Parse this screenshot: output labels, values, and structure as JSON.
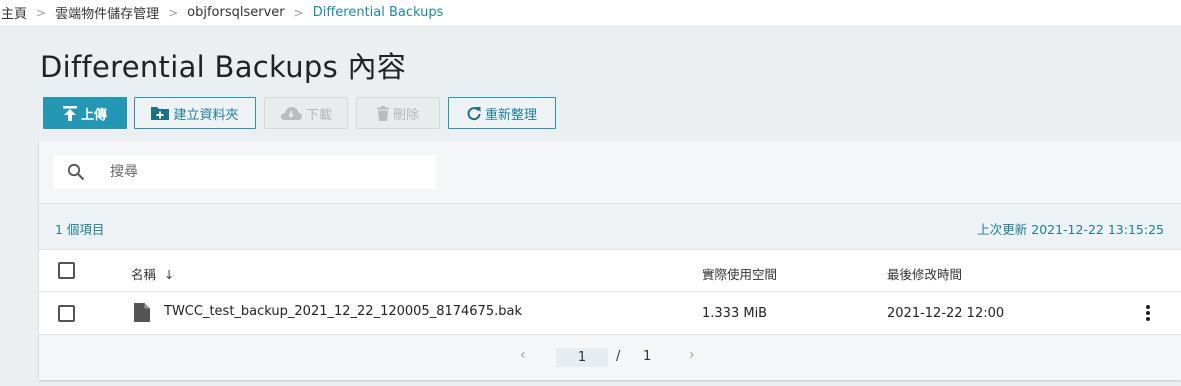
{
  "breadcrumb": {
    "items": [
      "主頁",
      "雲端物件儲存管理",
      "objforsqlserver",
      "Differential Backups"
    ],
    "separator": ">"
  },
  "page": {
    "title": "Differential Backups 內容"
  },
  "toolbar": {
    "upload_label": "上傳",
    "new_folder_label": "建立資料夾",
    "download_label": "下載",
    "delete_label": "刪除",
    "refresh_label": "重新整理"
  },
  "search": {
    "placeholder": "搜尋",
    "icon": "search-icon"
  },
  "list": {
    "count_label": "1 個項目",
    "updated_label": "上次更新 2021-12-22 13:15:25",
    "columns": {
      "name": "名稱",
      "size": "實際使用空間",
      "modified": "最後修改時間"
    },
    "sort_indicator": "↓",
    "rows": [
      {
        "name": "TWCC_test_backup_2021_12_22_120005_8174675.bak",
        "size": "1.333 MiB",
        "modified": "2021-12-22 12:00",
        "icon": "file-icon"
      }
    ]
  },
  "pagination": {
    "current": "1",
    "separator": "/",
    "total": "1"
  },
  "colors": {
    "accent": "#2397b3",
    "link": "#1c8aa8",
    "background": "#eceff1"
  }
}
